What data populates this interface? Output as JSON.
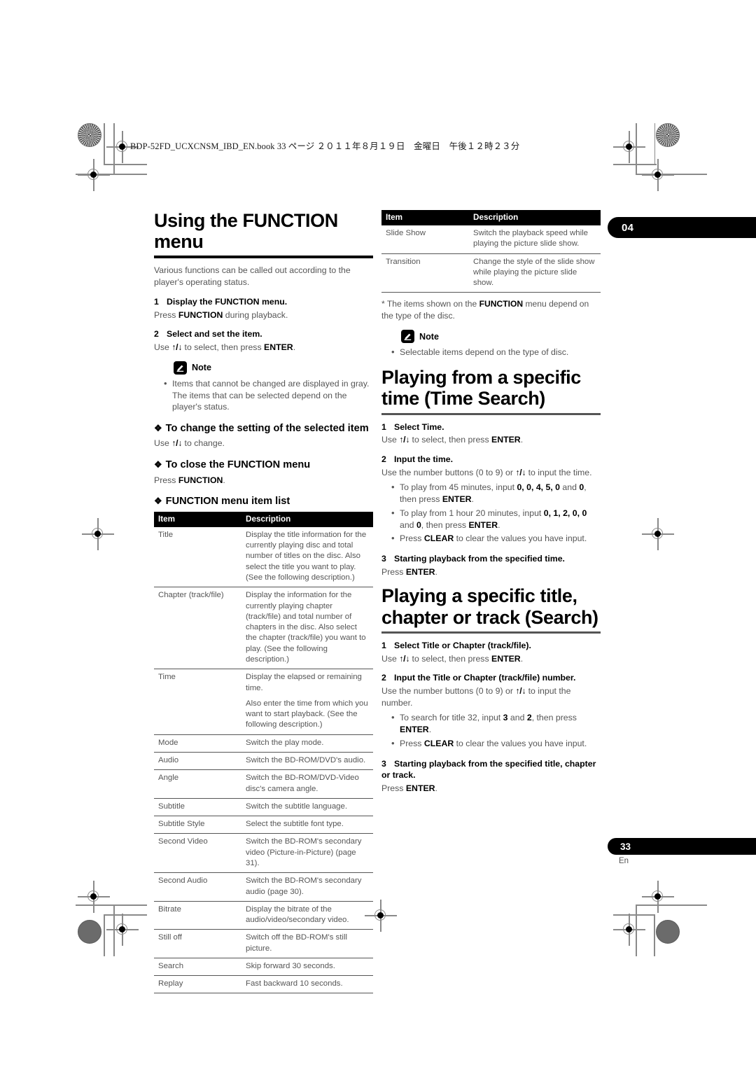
{
  "print_header": "BDP-52FD_UCXCNSM_IBD_EN.book  33 ページ  ２０１１年８月１９日　金曜日　午後１２時２３分",
  "chapter_tab": "04",
  "page_number": "33",
  "page_language": "En",
  "left_column": {
    "title": "Using the FUNCTION menu",
    "intro": "Various functions can be called out according to the player's operating status.",
    "steps": [
      {
        "num": "1",
        "title": "Display the FUNCTION menu.",
        "body_pre": "Press ",
        "body_bold": "FUNCTION",
        "body_post": " during playback."
      },
      {
        "num": "2",
        "title": "Select and set the item.",
        "body_pre": "Use ",
        "body_arrows": "↑/↓",
        "body_mid": " to select, then press ",
        "body_bold": "ENTER",
        "body_post": "."
      }
    ],
    "note": {
      "label": "Note",
      "items": [
        "Items that cannot be changed are displayed in gray. The items that can be selected depend on the player's status."
      ]
    },
    "subsections": [
      {
        "heading": "To change the setting of the selected item",
        "body_pre": "Use ",
        "body_arrows": "↑/↓",
        "body_post": " to change."
      },
      {
        "heading": "To close the FUNCTION menu",
        "body_pre": "Press ",
        "body_bold": "FUNCTION",
        "body_post": "."
      },
      {
        "heading": "FUNCTION menu item list"
      }
    ],
    "table": {
      "headers": [
        "Item",
        "Description"
      ],
      "rows": [
        [
          "Title",
          "Display the title information for the currently playing disc and total number of titles on the disc. Also select the title you want to play. (See the following description.)"
        ],
        [
          "Chapter (track/file)",
          "Display the information for the currently playing chapter (track/file) and total number of chapters in the disc. Also select the chapter (track/file) you want to play. (See the following description.)"
        ],
        [
          "Time",
          "Display the elapsed or remaining time."
        ],
        [
          "Mode",
          "Switch the play mode."
        ],
        [
          "Audio",
          "Switch the BD-ROM/DVD's audio."
        ],
        [
          "Angle",
          "Switch the BD-ROM/DVD-Video disc's camera angle."
        ],
        [
          "Subtitle",
          "Switch the subtitle language."
        ],
        [
          "Subtitle Style",
          "Select the subtitle font type."
        ],
        [
          "Second Video",
          "Switch the BD-ROM's secondary video (Picture-in-Picture) (page 31)."
        ],
        [
          "Second Audio",
          "Switch the BD-ROM's secondary audio (page 30)."
        ],
        [
          "Bitrate",
          "Display the bitrate of the audio/video/secondary video."
        ],
        [
          "Still off",
          "Switch off the BD-ROM's still picture."
        ],
        [
          "Search",
          "Skip forward 30 seconds."
        ],
        [
          "Replay",
          "Fast backward 10 seconds."
        ]
      ],
      "time_row_extra": "Also enter the time from which you want to start playback. (See the following description.)"
    }
  },
  "right_column": {
    "table": {
      "headers": [
        "Item",
        "Description"
      ],
      "rows": [
        [
          "Slide Show",
          "Switch the playback speed while playing the picture slide show."
        ],
        [
          "Transition",
          "Change the style of the slide show while playing the picture slide show."
        ]
      ]
    },
    "footnote_pre": "* The items shown on the ",
    "footnote_bold": "FUNCTION",
    "footnote_post": " menu depend on the type of the disc.",
    "note": {
      "label": "Note",
      "items": [
        "Selectable items depend on the type of disc."
      ]
    },
    "time_search": {
      "title": "Playing from a specific time (Time Search)",
      "steps": [
        {
          "num": "1",
          "title": "Select Time.",
          "body_pre": "Use ",
          "body_arrows": "↑/↓",
          "body_mid": " to select, then press ",
          "body_bold": "ENTER",
          "body_post": "."
        },
        {
          "num": "2",
          "title": "Input the time.",
          "body_pre": "Use the number buttons (0 to 9) or ",
          "body_arrows": "↑/↓",
          "body_post": " to input the time."
        }
      ],
      "bullets": [
        {
          "pre": "To play from 45 minutes, input ",
          "keys": "0, 0, 4, 5, 0",
          "mid": " and ",
          "keys2": "0",
          "post": ", then press ",
          "bold": "ENTER",
          "tail": "."
        },
        {
          "pre": "To play from 1 hour 20 minutes, input ",
          "keys": "0, 1, 2, 0, 0",
          "mid": " and ",
          "keys2": "0",
          "post": ", then press ",
          "bold": "ENTER",
          "tail": "."
        },
        {
          "pre": "Press ",
          "bold": "CLEAR",
          "post": " to clear the values you have input."
        }
      ],
      "final_step": {
        "num": "3",
        "title": "Starting playback from the specified time.",
        "body_pre": "Press ",
        "body_bold": "ENTER",
        "body_post": "."
      }
    },
    "title_search": {
      "title": "Playing a specific title, chapter or track (Search)",
      "steps": [
        {
          "num": "1",
          "title": "Select Title or Chapter (track/file).",
          "body_pre": "Use ",
          "body_arrows": "↑/↓",
          "body_mid": " to select, then press ",
          "body_bold": "ENTER",
          "body_post": "."
        },
        {
          "num": "2",
          "title": "Input the Title or Chapter (track/file) number.",
          "body_pre": "Use the number buttons (0 to 9) or ",
          "body_arrows": "↑/↓",
          "body_post": " to input the number."
        }
      ],
      "bullets": [
        {
          "pre": "To search for title 32, input ",
          "keys": "3",
          "mid": " and ",
          "keys2": "2",
          "post": ", then press ",
          "bold": "ENTER",
          "tail": "."
        },
        {
          "pre": "Press ",
          "bold": "CLEAR",
          "post": " to clear the values you have input."
        }
      ],
      "final_step": {
        "num": "3",
        "title": "Starting playback from the specified title, chapter or track.",
        "body_pre": "Press ",
        "body_bold": "ENTER",
        "body_post": "."
      }
    }
  }
}
